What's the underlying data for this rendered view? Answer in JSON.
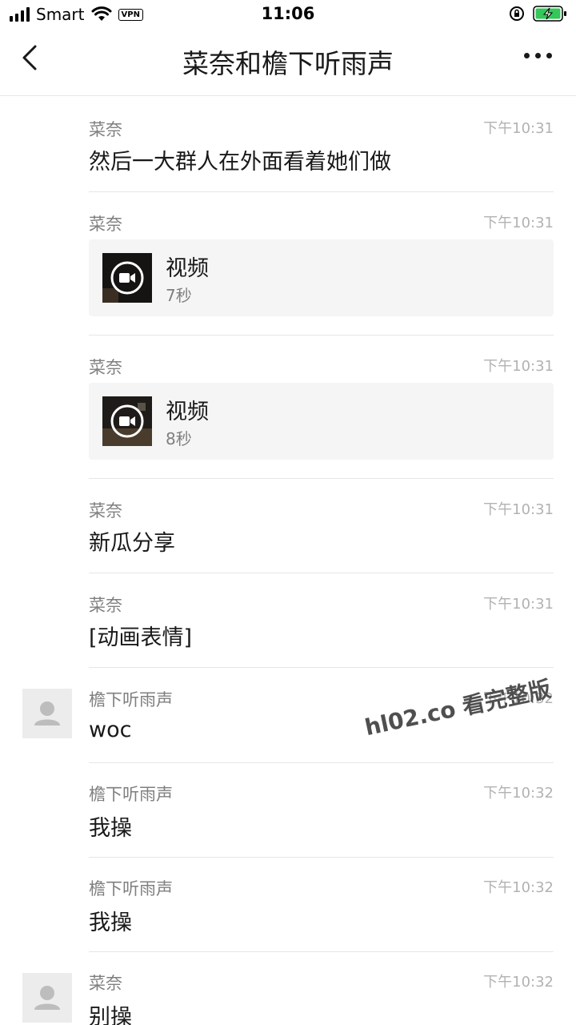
{
  "status_bar": {
    "carrier": "Smart",
    "vpn": "VPN",
    "time": "11:06",
    "battery_color": "#34c759"
  },
  "nav": {
    "title": "菜奈和檐下听雨声"
  },
  "messages": [
    {
      "sender": "菜奈",
      "time": "下午10:31",
      "text": "然后一大群人在外面看着她们做"
    },
    {
      "sender": "菜奈",
      "time": "下午10:31",
      "video_title": "视频",
      "video_duration": "7秒"
    },
    {
      "sender": "菜奈",
      "time": "下午10:31",
      "video_title": "视频",
      "video_duration": "8秒"
    },
    {
      "sender": "菜奈",
      "time": "下午10:31",
      "text": "新瓜分享"
    },
    {
      "sender": "菜奈",
      "time": "下午10:31",
      "text": "[动画表情]"
    },
    {
      "sender": "檐下听雨声",
      "time": "下午10:32",
      "text": "woc"
    },
    {
      "sender": "檐下听雨声",
      "time": "下午10:32",
      "text": "我操"
    },
    {
      "sender": "檐下听雨声",
      "time": "下午10:32",
      "text": "我操"
    },
    {
      "sender": "菜奈",
      "time": "下午10:32",
      "text": "别操"
    }
  ],
  "watermark": "hl02.co 看完整版"
}
